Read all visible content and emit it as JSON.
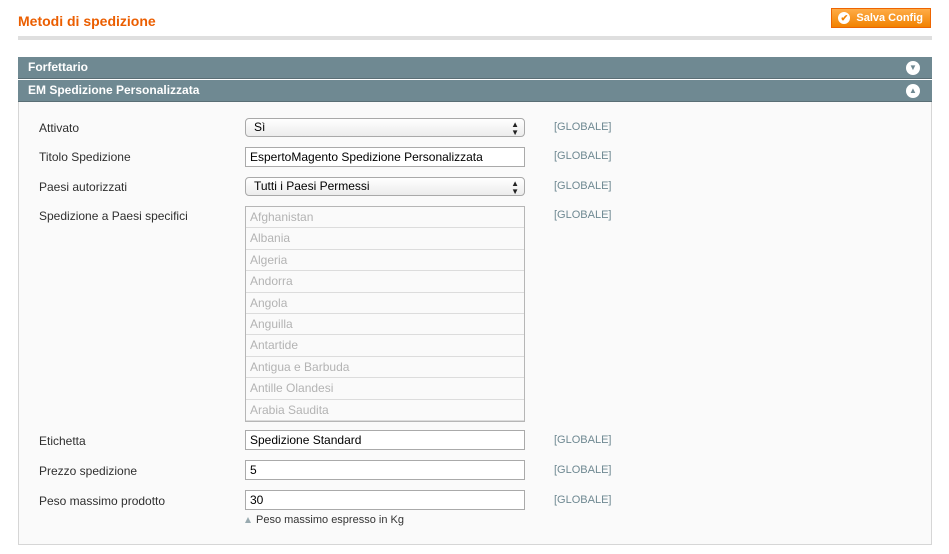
{
  "page": {
    "title": "Metodi di spedizione",
    "save_label": "Salva Config"
  },
  "sections": {
    "flat_rate": {
      "title": "Forfettario"
    },
    "custom": {
      "title": "EM Spedizione Personalizzata"
    }
  },
  "fields": {
    "enabled": {
      "label": "Attivato",
      "value": "Sì",
      "scope": "[GLOBALE]"
    },
    "title": {
      "label": "Titolo Spedizione",
      "value": "EspertoMagento Spedizione Personalizzata",
      "scope": "[GLOBALE]"
    },
    "allowed_countries": {
      "label": "Paesi autorizzati",
      "value": "Tutti i Paesi Permessi",
      "scope": "[GLOBALE]"
    },
    "specific_countries": {
      "label": "Spedizione a Paesi specifici",
      "scope": "[GLOBALE]",
      "options": [
        "Afghanistan",
        "Albania",
        "Algeria",
        "Andorra",
        "Angola",
        "Anguilla",
        "Antartide",
        "Antigua e Barbuda",
        "Antille Olandesi",
        "Arabia Saudita"
      ]
    },
    "label_field": {
      "label": "Etichetta",
      "value": "Spedizione Standard",
      "scope": "[GLOBALE]"
    },
    "price": {
      "label": "Prezzo spedizione",
      "value": "5",
      "scope": "[GLOBALE]"
    },
    "max_weight": {
      "label": "Peso massimo prodotto",
      "value": "30",
      "scope": "[GLOBALE]",
      "note": "Peso massimo espresso in Kg"
    }
  }
}
